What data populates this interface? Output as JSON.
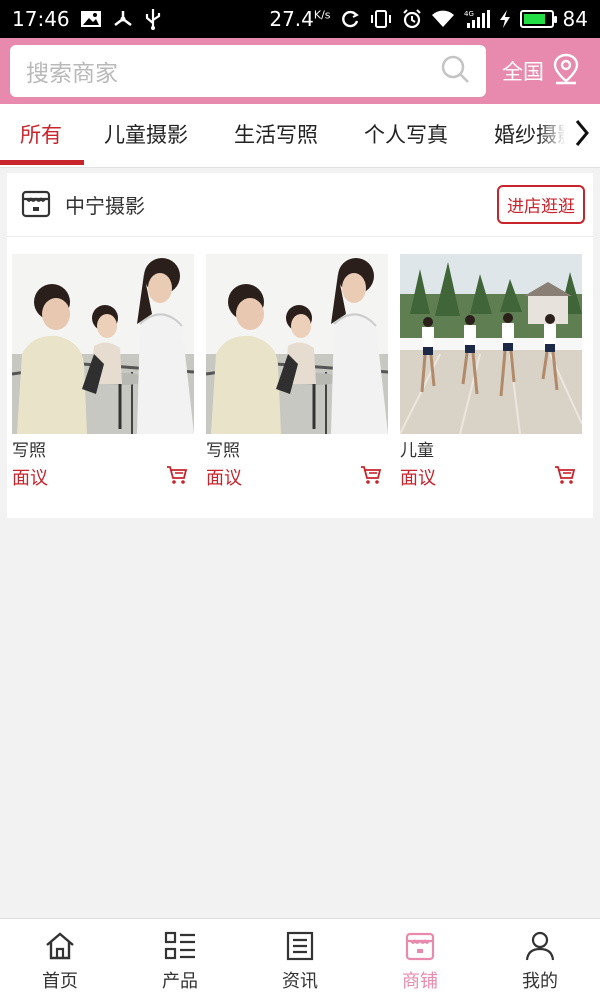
{
  "status_bar": {
    "time": "17:46",
    "speed": "27.4",
    "speed_unit": "K/s",
    "battery": "84",
    "battery_level": 0.84
  },
  "search": {
    "placeholder": "搜索商家",
    "region_label": "全国"
  },
  "tabs": [
    {
      "label": "所有",
      "active": true
    },
    {
      "label": "儿童摄影",
      "active": false
    },
    {
      "label": "生活写照",
      "active": false
    },
    {
      "label": "个人写真",
      "active": false
    },
    {
      "label": "婚纱摄影",
      "active": false
    }
  ],
  "store": {
    "name": "中宁摄影",
    "visit_label": "进店逛逛",
    "products": [
      {
        "name": "写照",
        "price": "面议",
        "image": "women-at-cafe-table"
      },
      {
        "name": "写照",
        "price": "面议",
        "image": "women-at-cafe-table"
      },
      {
        "name": "儿童",
        "price": "面议",
        "image": "children-running-race"
      }
    ]
  },
  "bottom_nav": [
    {
      "label": "首页",
      "icon": "home-icon",
      "active": false
    },
    {
      "label": "产品",
      "icon": "product-list-icon",
      "active": false
    },
    {
      "label": "资讯",
      "icon": "news-icon",
      "active": false
    },
    {
      "label": "商铺",
      "icon": "store-icon",
      "active": true
    },
    {
      "label": "我的",
      "icon": "profile-icon",
      "active": false
    }
  ],
  "colors": {
    "accent_pink": "#e88aad",
    "accent_red": "#c9242c",
    "background": "#f2f2f2"
  }
}
